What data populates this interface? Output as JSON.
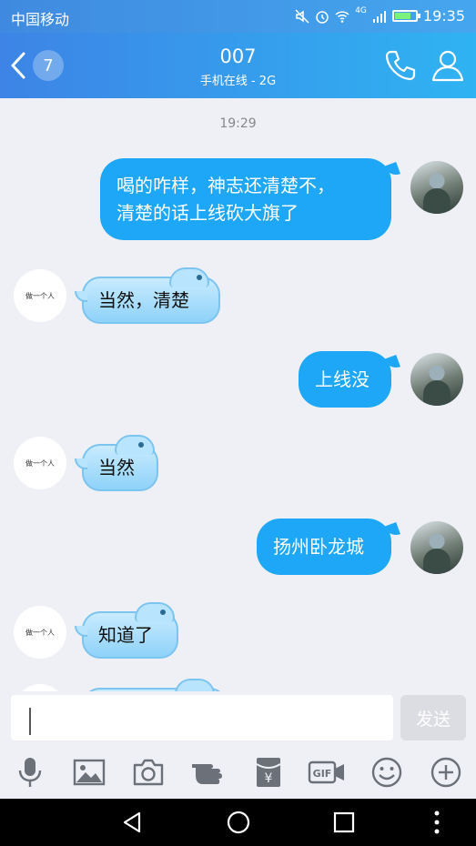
{
  "status_bar": {
    "carrier": "中国移动",
    "network": "4G",
    "time": "19:35"
  },
  "header": {
    "unread_count": "7",
    "title": "007",
    "subtitle": "手机在线 - 2G"
  },
  "chat": {
    "timestamp": "19:29",
    "left_avatar_text": "做一个人",
    "messages": [
      {
        "side": "out",
        "line1": "喝的咋样，神志还清楚不，",
        "line2": "清楚的话上线砍大旗了"
      },
      {
        "side": "in",
        "text": "当然，清楚"
      },
      {
        "side": "out",
        "text": "上线没"
      },
      {
        "side": "in",
        "text": "当然"
      },
      {
        "side": "out",
        "text": "扬州卧龙城"
      },
      {
        "side": "in",
        "text": "知道了"
      }
    ]
  },
  "composer": {
    "send_label": "发送"
  },
  "toolbar": {
    "gif_label": "GIF",
    "yuan_label": "¥"
  }
}
